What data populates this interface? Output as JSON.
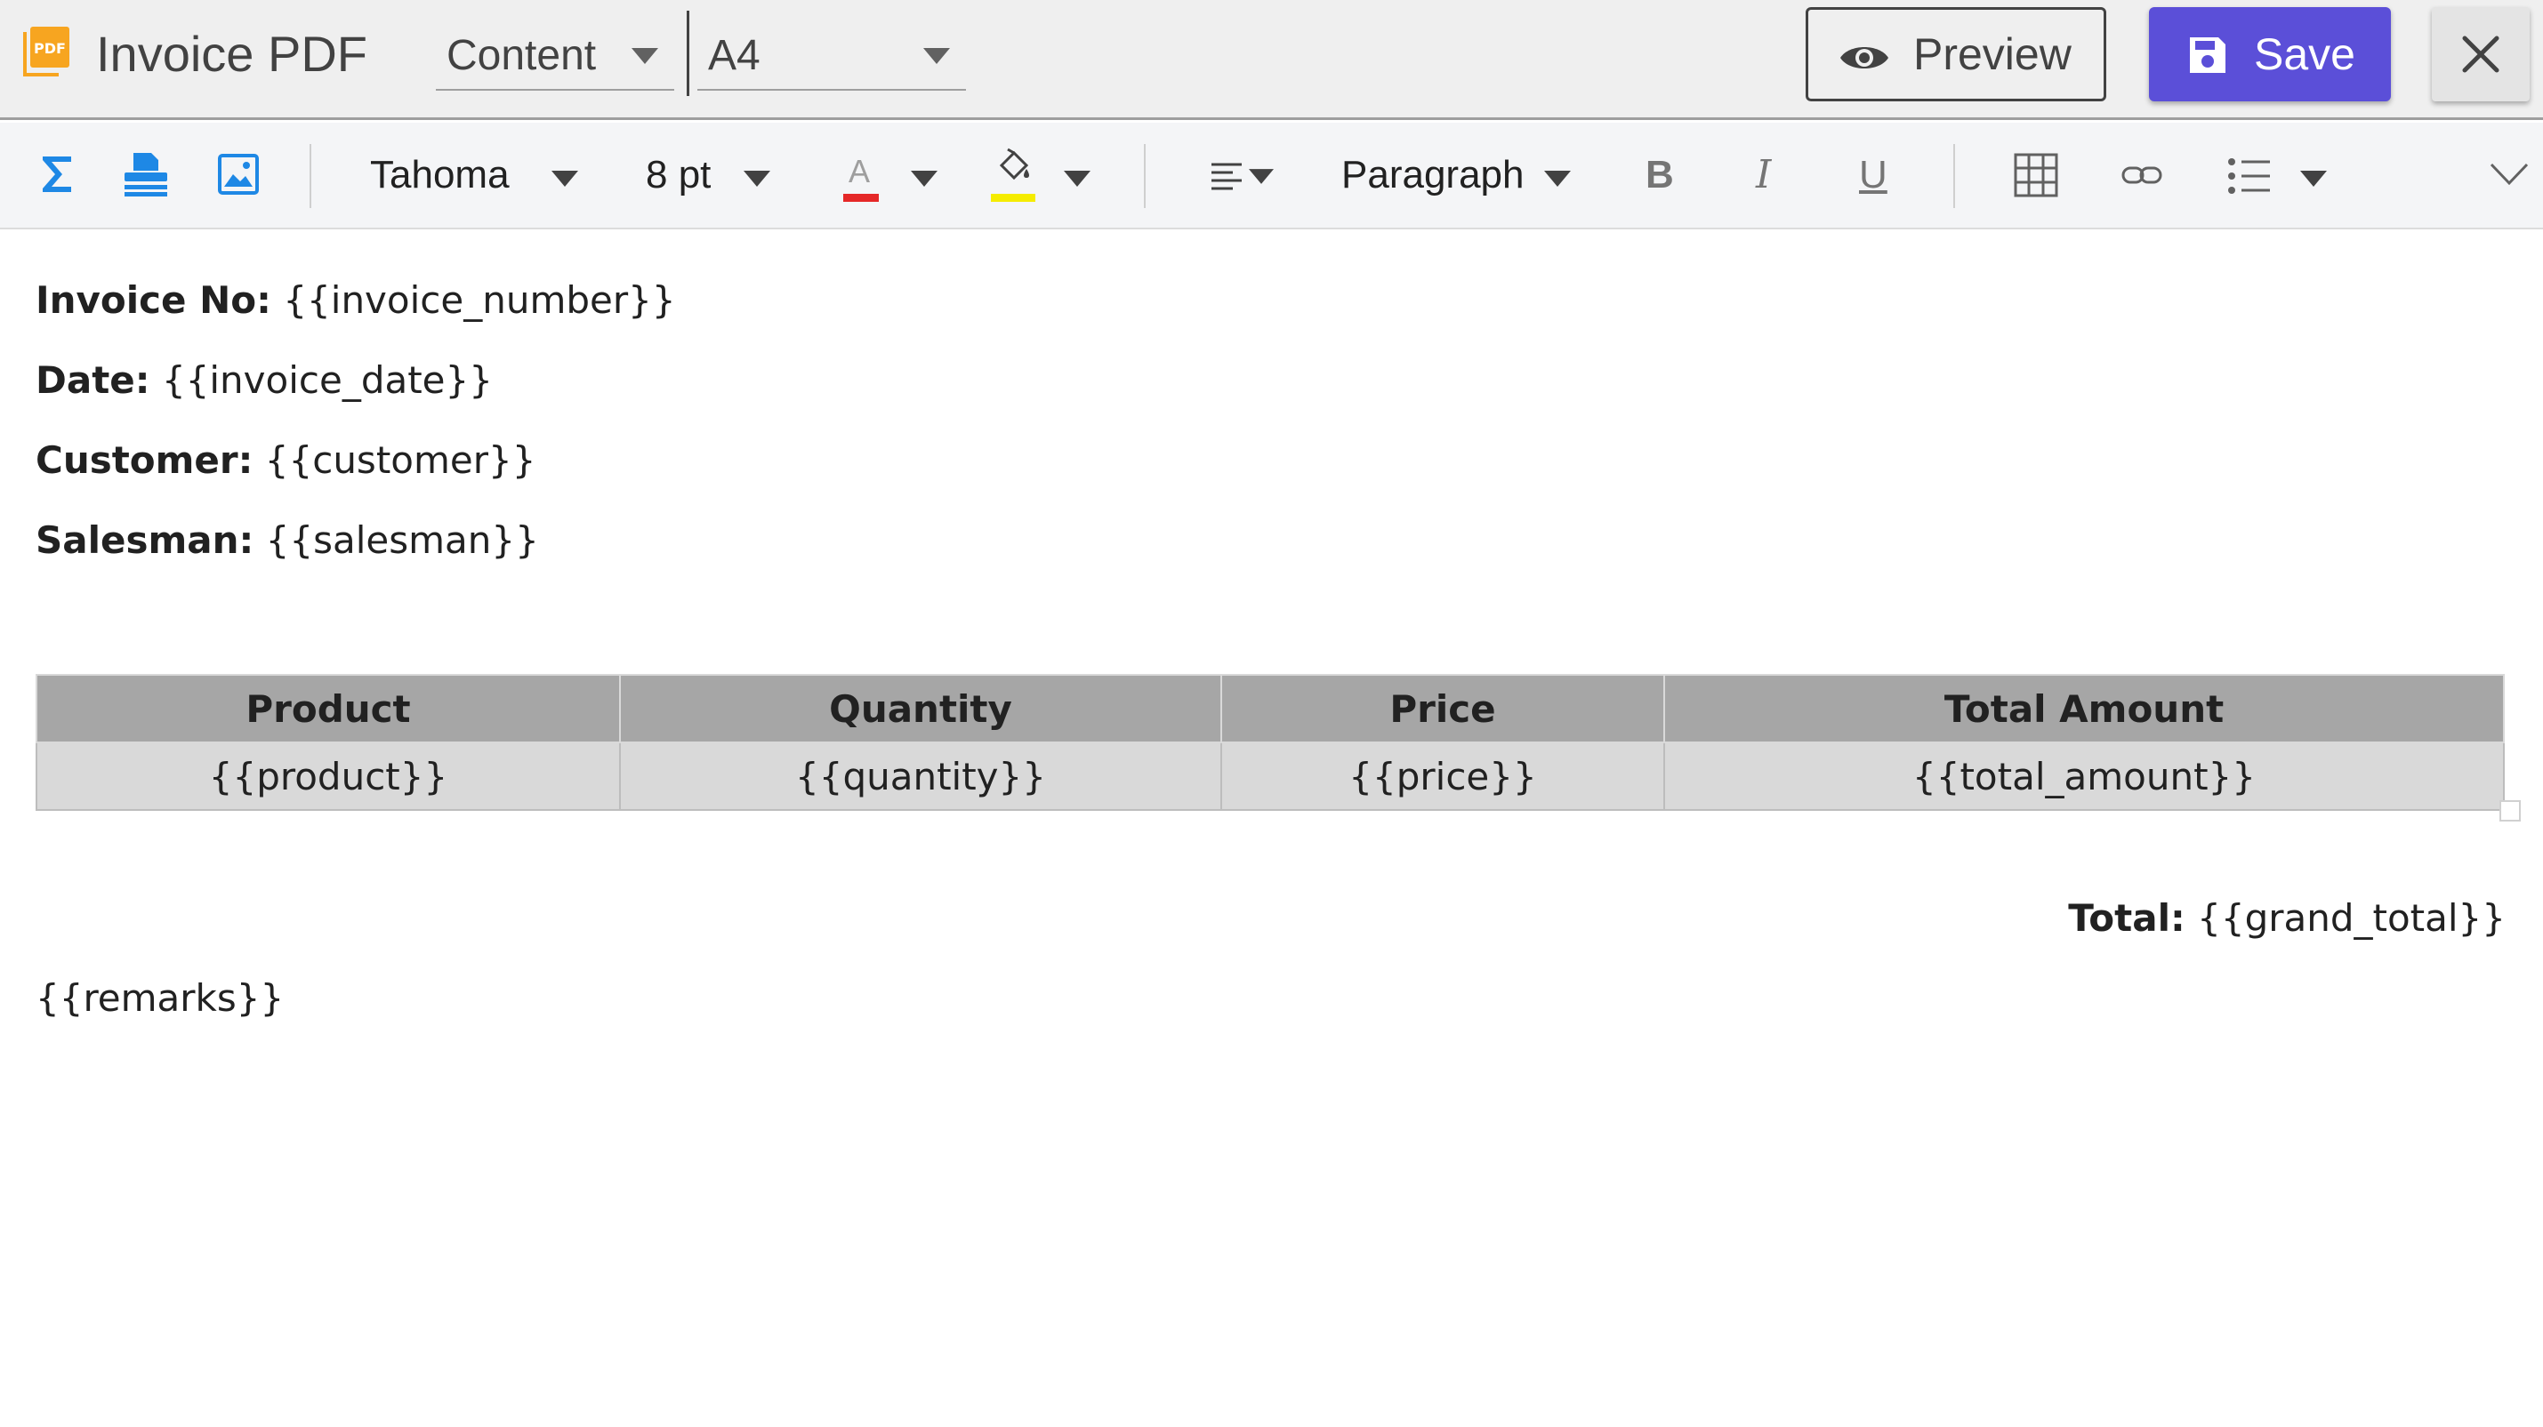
{
  "header": {
    "app_title": "Invoice PDF",
    "content_select": {
      "value": "Content"
    },
    "page_size_select": {
      "value": "A4"
    },
    "preview_label": "Preview",
    "save_label": "Save",
    "colors": {
      "save_bg": "#5b4fd8",
      "logo": "#f7a520"
    }
  },
  "toolbar": {
    "font_family": "Tahoma",
    "font_size": "8 pt",
    "block_format": "Paragraph",
    "text_color": "#e52828",
    "highlight_color": "#f5ec00",
    "icons": [
      "sigma-icon",
      "stamp-icon",
      "image-icon",
      "text-color-icon",
      "highlight-icon",
      "align-left-icon",
      "bold-icon",
      "italic-icon",
      "underline-icon",
      "table-icon",
      "link-icon",
      "bulleted-list-icon",
      "chevron-down-icon"
    ],
    "bold_glyph": "B",
    "italic_glyph": "I",
    "underline_glyph": "U",
    "text_color_glyph": "A"
  },
  "document": {
    "fields": [
      {
        "label": "Invoice No:",
        "value": "{{invoice_number}}"
      },
      {
        "label": "Date:",
        "value": "{{invoice_date}}"
      },
      {
        "label": "Customer:",
        "value": "{{customer}}"
      },
      {
        "label": "Salesman:",
        "value": "{{salesman}}"
      }
    ],
    "table": {
      "headers": [
        "Product",
        "Quantity",
        "Price",
        "Total Amount"
      ],
      "rows": [
        [
          "{{product}}",
          "{{quantity}}",
          "{{price}}",
          "{{total_amount}}"
        ]
      ]
    },
    "total": {
      "label": "Total:",
      "value": "{{grand_total}}"
    },
    "remarks": "{{remarks}}"
  }
}
